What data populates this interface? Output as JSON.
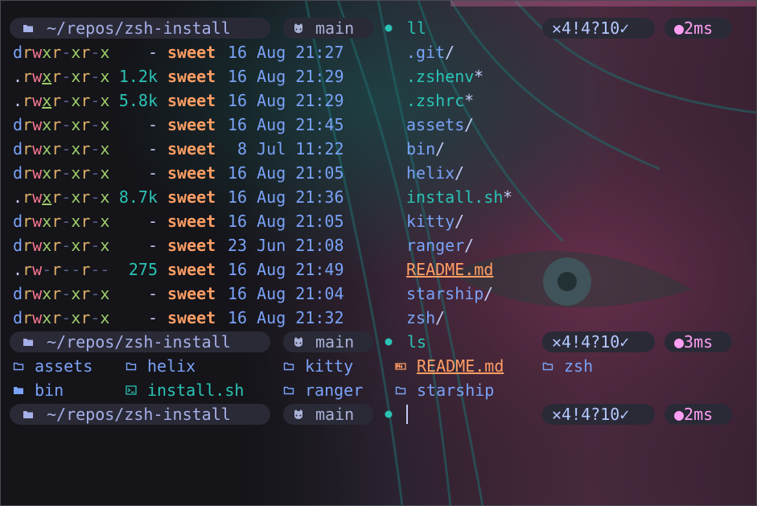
{
  "colors": {
    "prompt_pill_bg": "#2a2a37",
    "directory_blue": "#7aa2f7",
    "cyan": "#2ac3b5",
    "owner_orange": "#ff9e64",
    "time_pink": "#ff9ff3"
  },
  "prompts": [
    {
      "dir": "~/repos/zsh-install",
      "branch": "main",
      "cmd": "ll",
      "git_status": "✕4!4?10✓",
      "duration": "●2ms"
    },
    {
      "dir": "~/repos/zsh-install",
      "branch": "main",
      "cmd": "ls",
      "git_status": "✕4!4?10✓",
      "duration": "●3ms"
    },
    {
      "dir": "~/repos/zsh-install",
      "branch": "main",
      "cmd": "",
      "git_status": "✕4!4?10✓",
      "duration": "●2ms"
    }
  ],
  "icons": {
    "folder": "folder-icon",
    "git_branch": "git-branch-icon",
    "dot": "status-dot-icon",
    "markdown": "markdown-icon",
    "terminal": "terminal-icon"
  },
  "listing": [
    {
      "perm": "drwxr-xr-x",
      "size": "-",
      "owner": "sweet",
      "date": "16 Aug 21:27",
      "name": ".git",
      "suffix": "/",
      "kind": "dir"
    },
    {
      "perm": ".rwxr-xr-x",
      "size": "1.2k",
      "owner": "sweet",
      "date": "16 Aug 21:29",
      "name": ".zshenv",
      "suffix": "*",
      "kind": "exec"
    },
    {
      "perm": ".rwxr-xr-x",
      "size": "5.8k",
      "owner": "sweet",
      "date": "16 Aug 21:29",
      "name": ".zshrc",
      "suffix": "*",
      "kind": "exec"
    },
    {
      "perm": "drwxr-xr-x",
      "size": "-",
      "owner": "sweet",
      "date": "16 Aug 21:45",
      "name": "assets",
      "suffix": "/",
      "kind": "dir"
    },
    {
      "perm": "drwxr-xr-x",
      "size": "-",
      "owner": "sweet",
      "date": " 8 Jul 11:22",
      "name": "bin",
      "suffix": "/",
      "kind": "dir"
    },
    {
      "perm": "drwxr-xr-x",
      "size": "-",
      "owner": "sweet",
      "date": "16 Aug 21:05",
      "name": "helix",
      "suffix": "/",
      "kind": "dir"
    },
    {
      "perm": ".rwxr-xr-x",
      "size": "8.7k",
      "owner": "sweet",
      "date": "16 Aug 21:36",
      "name": "install.sh",
      "suffix": "*",
      "kind": "exec"
    },
    {
      "perm": "drwxr-xr-x",
      "size": "-",
      "owner": "sweet",
      "date": "16 Aug 21:05",
      "name": "kitty",
      "suffix": "/",
      "kind": "dir"
    },
    {
      "perm": "drwxr-xr-x",
      "size": "-",
      "owner": "sweet",
      "date": "23 Jun 21:08",
      "name": "ranger",
      "suffix": "/",
      "kind": "dir"
    },
    {
      "perm": ".rw-r--r--",
      "size": "275",
      "owner": "sweet",
      "date": "16 Aug 21:49",
      "name": "README.md",
      "suffix": "",
      "kind": "md"
    },
    {
      "perm": "drwxr-xr-x",
      "size": "-",
      "owner": "sweet",
      "date": "16 Aug 21:04",
      "name": "starship",
      "suffix": "/",
      "kind": "dir"
    },
    {
      "perm": "drwxr-xr-x",
      "size": "-",
      "owner": "sweet",
      "date": "16 Aug 21:32",
      "name": "zsh",
      "suffix": "/",
      "kind": "dir"
    }
  ],
  "ls_grid": [
    [
      {
        "name": "assets",
        "kind": "dir",
        "icon": "folder-icon"
      },
      {
        "name": "helix",
        "kind": "dir",
        "icon": "folder-icon"
      },
      {
        "name": "kitty",
        "kind": "dir",
        "icon": "folder-icon"
      },
      {
        "name": "README.md",
        "kind": "md",
        "icon": "markdown-icon"
      },
      {
        "name": "zsh",
        "kind": "dir",
        "icon": "folder-icon"
      }
    ],
    [
      {
        "name": "bin",
        "kind": "dir",
        "icon": "folder-icon"
      },
      {
        "name": "install.sh",
        "kind": "exec",
        "icon": "terminal-icon"
      },
      {
        "name": "ranger",
        "kind": "dir",
        "icon": "folder-icon"
      },
      {
        "name": "starship",
        "kind": "dir",
        "icon": "folder-icon"
      }
    ]
  ]
}
